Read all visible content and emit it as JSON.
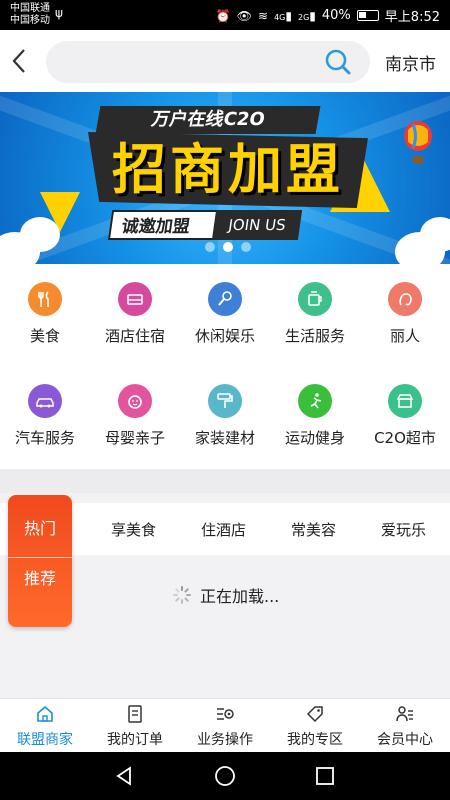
{
  "status_bar": {
    "carrier_1": "中国联通",
    "carrier_2": "中国移动",
    "signal_1": "4G",
    "signal_2": "2G",
    "battery": "40%",
    "time": "早上8:52"
  },
  "header": {
    "search_placeholder": "",
    "city": "南京市"
  },
  "banner": {
    "subtitle": "万户在线C2O",
    "title": "招商加盟",
    "invite": "诚邀加盟",
    "join": "JOIN US",
    "slides": 3,
    "active_slide": 1
  },
  "categories": [
    {
      "label": "美食",
      "icon": "utensils-icon",
      "color": "#f58a2f"
    },
    {
      "label": "酒店住宿",
      "icon": "bed-icon",
      "color": "#d64a9e"
    },
    {
      "label": "休闲娱乐",
      "icon": "microphone-icon",
      "color": "#3f7fd6"
    },
    {
      "label": "生活服务",
      "icon": "cup-icon",
      "color": "#3fbf8a"
    },
    {
      "label": "丽人",
      "icon": "woman-icon",
      "color": "#f07a6a"
    },
    {
      "label": "汽车服务",
      "icon": "car-icon",
      "color": "#8a5ad6"
    },
    {
      "label": "母婴亲子",
      "icon": "baby-icon",
      "color": "#e2559c"
    },
    {
      "label": "家装建材",
      "icon": "paint-roller-icon",
      "color": "#5ab6c9"
    },
    {
      "label": "运动健身",
      "icon": "running-icon",
      "color": "#3bbf3b"
    },
    {
      "label": "C2O超市",
      "icon": "shop-icon",
      "color": "#3ac08a"
    }
  ],
  "recommend": {
    "badge_top": "热门",
    "badge_bottom": "推荐",
    "tabs": [
      "享美食",
      "住酒店",
      "常美容",
      "爱玩乐"
    ],
    "loading": "正在加载..."
  },
  "tabbar": {
    "items": [
      {
        "label": "联盟商家",
        "icon": "home-icon",
        "active": true
      },
      {
        "label": "我的订单",
        "icon": "order-icon",
        "active": false
      },
      {
        "label": "业务操作",
        "icon": "settings-icon",
        "active": false
      },
      {
        "label": "我的专区",
        "icon": "tag-icon",
        "active": false
      },
      {
        "label": "会员中心",
        "icon": "member-icon",
        "active": false
      }
    ],
    "active_color": "#1a8fd6"
  },
  "system_nav": [
    "back-icon",
    "home-circle-icon",
    "recents-icon"
  ]
}
